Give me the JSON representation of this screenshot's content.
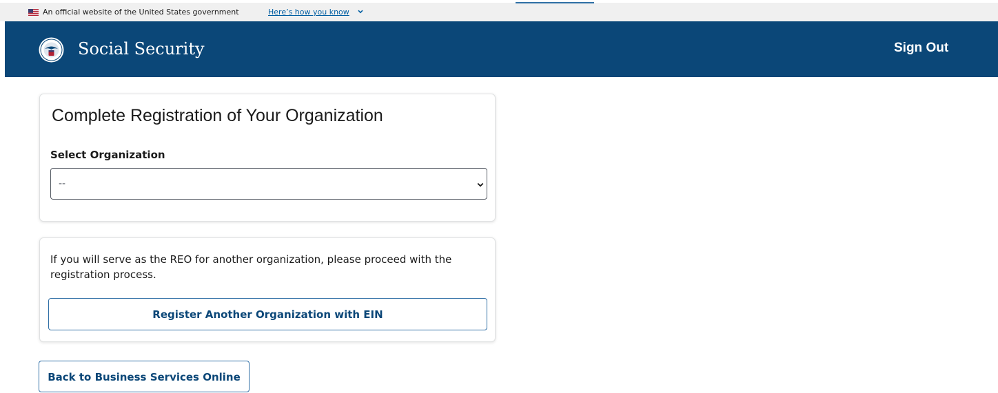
{
  "gov_banner": {
    "official_text": "An official website of the United States government",
    "how_link": "Here’s how you know",
    "flag_icon": "us-flag-icon",
    "chevron_icon": "chevron-down-icon"
  },
  "header": {
    "title": "Social Security",
    "sign_out": "Sign Out",
    "logo_icon": "ssa-seal-icon",
    "background": "#0b4778"
  },
  "registration_card": {
    "title": "Complete Registration of Your Organization",
    "select_label": "Select Organization",
    "select_value": "--"
  },
  "reo_card": {
    "text": "If you will serve as the REO for another organization, please proceed with the registration process.",
    "register_button": "Register Another Organization with EIN"
  },
  "back_button": "Back to Business Services Online",
  "colors": {
    "accent": "#0b4778",
    "button_border": "#2f6ea5",
    "link": "#005ea2"
  }
}
